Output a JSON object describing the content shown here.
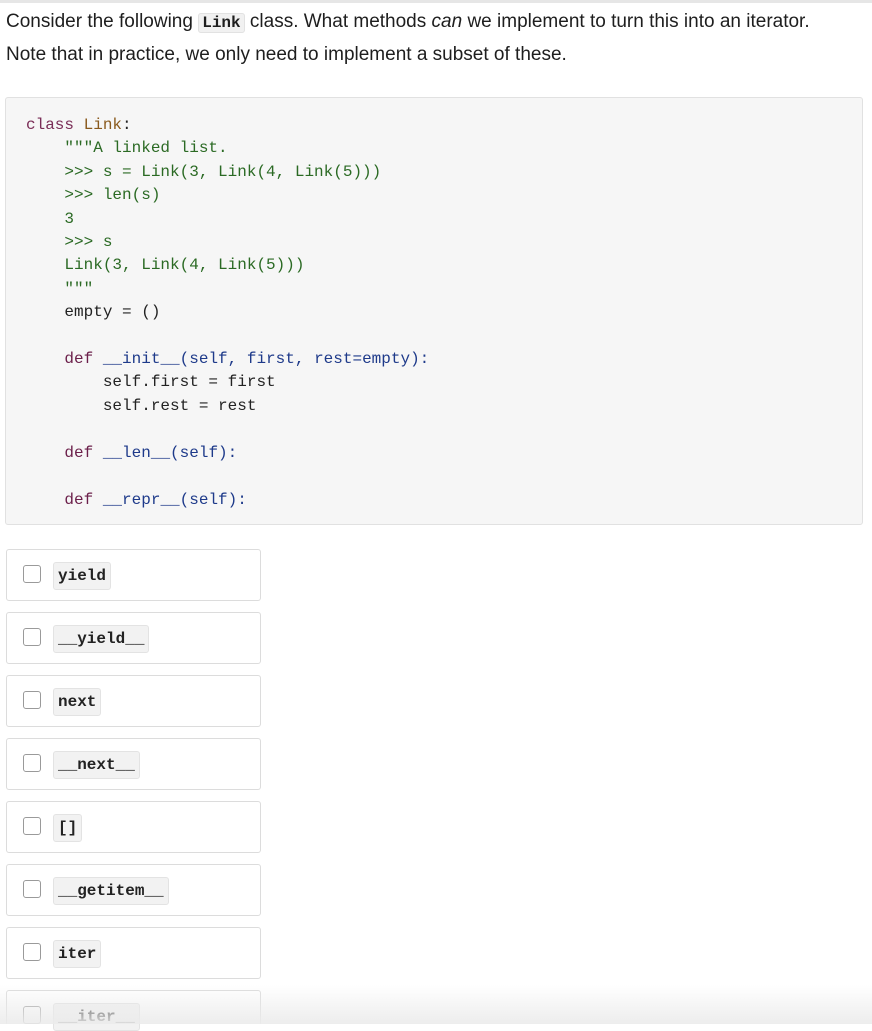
{
  "question": {
    "part1": "Consider the following ",
    "class_name": "Link",
    "part2": " class. What methods ",
    "emph": "can",
    "part3": " we implement to turn this into an iterator.",
    "line2": "Note that in practice, we only need to implement a subset of these."
  },
  "code": {
    "l1_kw": "class",
    "l1_name": "Link",
    "l1_colon": ":",
    "l2": "    \"\"\"A linked list.",
    "l3": "    >>> s = Link(3, Link(4, Link(5)))",
    "l4": "    >>> len(s)",
    "l5": "    3",
    "l6": "    >>> s",
    "l7": "    Link(3, Link(4, Link(5)))",
    "l8": "    \"\"\"",
    "l9": "    empty = ()",
    "l11_def": "def",
    "l11_rest": "__init__(self, first, rest=empty):",
    "l12": "        self.first = first",
    "l13": "        self.rest = rest",
    "l15_def": "def",
    "l15_rest": "__len__(self):",
    "l17_def": "def",
    "l17_rest": "__repr__(self):"
  },
  "options": [
    {
      "label": "yield"
    },
    {
      "label": "__yield__"
    },
    {
      "label": "next"
    },
    {
      "label": "__next__"
    },
    {
      "label": "[]"
    },
    {
      "label": "__getitem__"
    },
    {
      "label": "iter"
    },
    {
      "label": "__iter__"
    }
  ]
}
